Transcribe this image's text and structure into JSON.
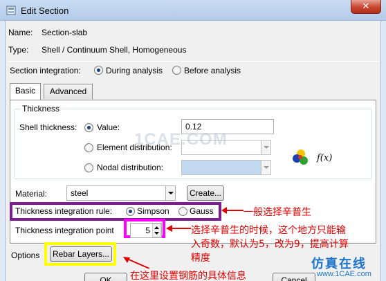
{
  "window": {
    "title": "Edit Section",
    "close_glyph": "✕"
  },
  "section": {
    "name_label": "Name:",
    "name_value": "Section-slab",
    "type_label": "Type:",
    "type_value": "Shell / Continuum Shell, Homogeneous"
  },
  "integration": {
    "label": "Section integration:",
    "options": [
      "During analysis",
      "Before analysis"
    ],
    "selected": "During analysis"
  },
  "tabs": [
    {
      "label": "Basic",
      "active": true
    },
    {
      "label": "Advanced",
      "active": false
    }
  ],
  "thickness": {
    "group_title": "Thickness",
    "shell_label": "Shell thickness:",
    "value_label": "Value:",
    "value": "0.12",
    "element_distribution_label": "Element distribution:",
    "nodal_distribution_label": "Nodal distribution:",
    "fx_label": "f(x)"
  },
  "material": {
    "label": "Material:",
    "value": "steel",
    "create_button": "Create..."
  },
  "rule": {
    "label": "Thickness integration rule:",
    "options": [
      "Simpson",
      "Gauss"
    ],
    "selected": "Simpson"
  },
  "points": {
    "label": "Thickness integration point",
    "value": "5"
  },
  "options": {
    "label": "Options",
    "rebar_button": "Rebar Layers..."
  },
  "footer": {
    "ok_button": "OK",
    "cancel_button": "Cancel"
  },
  "annotations": {
    "rule_note": "一般选择辛普生",
    "points_note_line1": "选择辛普生的时候，这个地方只能输",
    "points_note_line2": "入奇数，默认为5，改为9，提高计算",
    "points_note_line3": "精度",
    "rebar_note": "在这里设置钢筋的具体信息",
    "watermark_site": "仿真在线",
    "watermark_url": "www.1CAE.com",
    "watermark_center": "1CAE.COM"
  },
  "colors": {
    "rule_highlight": "#7b1f8f",
    "points_highlight": "#ff00ff",
    "rebar_highlight": "#ffff00",
    "annotation_text": "#e00000"
  }
}
